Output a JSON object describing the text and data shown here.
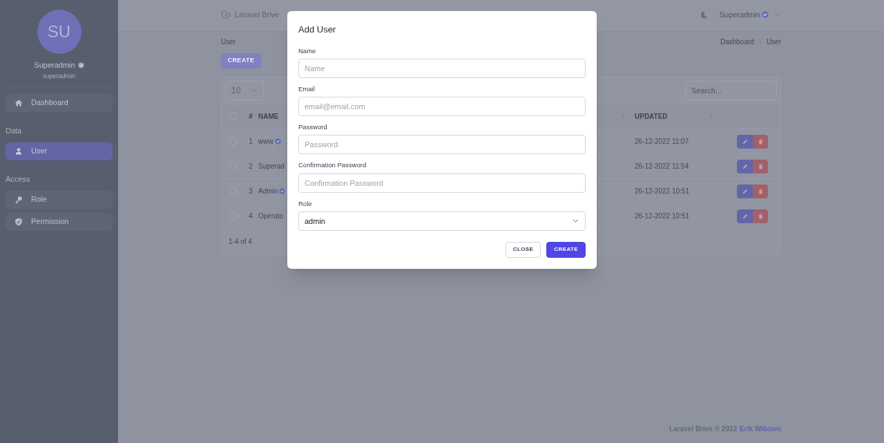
{
  "sidebar": {
    "avatar": "SU",
    "name": "Superadmin",
    "verified": true,
    "username": "superadmin",
    "menu": [
      {
        "kind": "item",
        "label": "Dashboard",
        "selected": false
      },
      {
        "kind": "heading",
        "label": "Data"
      },
      {
        "kind": "item",
        "label": "User",
        "selected": true
      },
      {
        "kind": "heading",
        "label": "Access"
      },
      {
        "kind": "item",
        "label": "Role",
        "selected": false
      },
      {
        "kind": "item",
        "label": "Permission",
        "selected": false
      }
    ]
  },
  "header": {
    "app_name": "Laravel Brive",
    "user": "Superadmin",
    "verified": true
  },
  "breadcrumb": {
    "page": "User",
    "trail": [
      "Dashboard",
      "User"
    ]
  },
  "create_button": "CREATE",
  "table": {
    "page_size": "10",
    "search_placeholder": "Search...",
    "all_checked": false,
    "columns": [
      {
        "label": "#",
        "sortable": false
      },
      {
        "label": "NAME",
        "sortable": false
      },
      {
        "sortable": true
      },
      {
        "label": "UPDATED",
        "sortable": true
      }
    ],
    "rows": [
      {
        "checked": false,
        "number": "1",
        "name": "www",
        "verified": true,
        "updated": "26-12-2022 11:07"
      },
      {
        "checked": false,
        "number": "2",
        "name": "Superad",
        "verified": false,
        "updated": "26-12-2022 11:54"
      },
      {
        "checked": false,
        "number": "3",
        "name": "Admin",
        "verified": true,
        "updated": "26-12-2022 10:51"
      },
      {
        "checked": false,
        "number": "4",
        "name": "Operato",
        "verified": false,
        "updated": "26-12-2022 10:51"
      }
    ],
    "footer": "1-4 of 4"
  },
  "dialog": {
    "title": "Add User",
    "fields": [
      {
        "kind": "input",
        "label": "Name",
        "placeholder": "Name"
      },
      {
        "kind": "input",
        "label": "Email",
        "placeholder": "email@email.com"
      },
      {
        "kind": "input",
        "label": "Password",
        "placeholder": "Password"
      },
      {
        "kind": "input",
        "label": "Confirmation Password",
        "placeholder": "Confirmation Password"
      },
      {
        "kind": "select",
        "label": "Role",
        "value": "admin"
      }
    ],
    "buttons": [
      {
        "kind": "secondary",
        "label": "CLOSE"
      },
      {
        "kind": "primary",
        "label": "CREATE"
      }
    ]
  },
  "footer": {
    "text": "Laravel Brive © 2022",
    "author": "Erik Wibowo"
  }
}
